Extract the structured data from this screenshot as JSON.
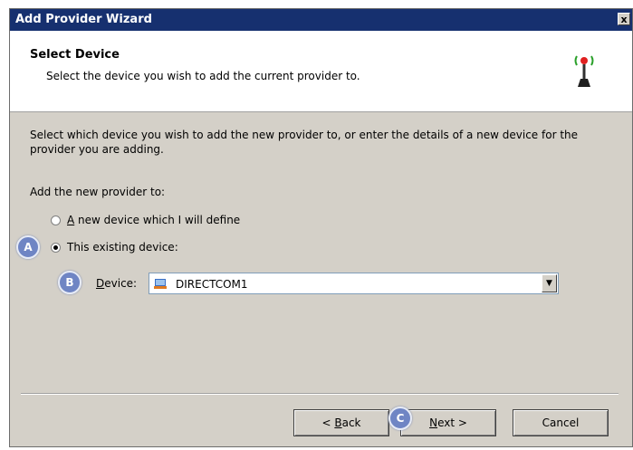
{
  "window": {
    "title": "Add Provider Wizard",
    "close_glyph": "x"
  },
  "header": {
    "title": "Select Device",
    "subtitle": "Select the device you wish to add the current provider to.",
    "icon": "antenna-icon"
  },
  "body": {
    "description": "Select which device you wish to add the new provider to, or enter the details of a new device for the provider you are adding.",
    "add_label": "Add the new provider to:",
    "options": [
      {
        "mnemonic": "A",
        "rest": " new device which I will define",
        "selected": false
      },
      {
        "mnemonic": "",
        "rest": "This existing device:",
        "selected": true
      }
    ],
    "device": {
      "label_mnemonic": "D",
      "label_rest": "evice:",
      "value": "DIRECTCOM1",
      "icon": "device-icon"
    }
  },
  "callouts": {
    "a": "A",
    "b": "B",
    "c": "C"
  },
  "buttons": {
    "back_prefix": "< ",
    "back_mnemonic": "B",
    "back_rest": "ack",
    "next_mnemonic": "N",
    "next_rest": "ext >",
    "cancel": "Cancel"
  }
}
